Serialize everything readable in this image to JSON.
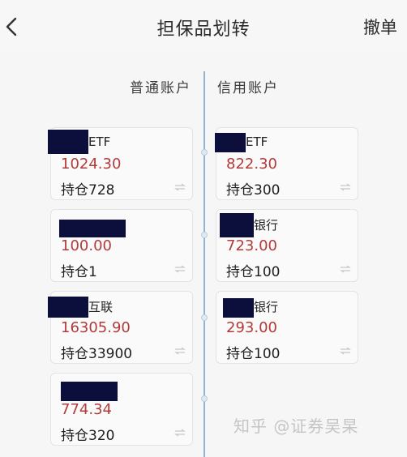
{
  "header": {
    "title": "担保品划转",
    "revoke_label": "撤单"
  },
  "columns": {
    "left": "普通账户",
    "right": "信用账户"
  },
  "ordinary_account": [
    {
      "name_suffix": "ETF",
      "price": "1024.30",
      "holding": "持仓728"
    },
    {
      "name_suffix": "",
      "price": "100.00",
      "holding": "持仓1"
    },
    {
      "name_suffix": "互联",
      "price": "16305.90",
      "holding": "持仓33900"
    },
    {
      "name_suffix": "",
      "price": "774.34",
      "holding": "持仓320"
    }
  ],
  "credit_account": [
    {
      "name_suffix": "ETF",
      "price": "822.30",
      "holding": "持仓300"
    },
    {
      "name_suffix": "银行",
      "price": "723.00",
      "holding": "持仓100"
    },
    {
      "name_suffix": "银行",
      "price": "293.00",
      "holding": "持仓100"
    }
  ],
  "watermark": "知乎 @证券吴杲",
  "colors": {
    "price": "#b23a3a",
    "divider": "#8fb3d0",
    "redaction": "#0c0f3c"
  }
}
